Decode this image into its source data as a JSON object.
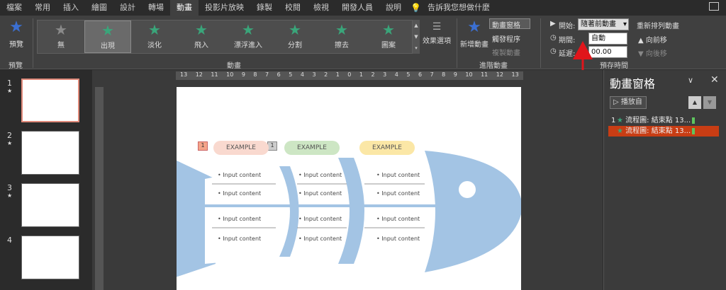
{
  "tabs": [
    "檔案",
    "常用",
    "插入",
    "繪圖",
    "設計",
    "轉場",
    "動畫",
    "投影片放映",
    "錄製",
    "校閱",
    "檢視",
    "開發人員",
    "說明"
  ],
  "tell_me": "告訴我您想做什麼",
  "ribbon": {
    "preview": "預覽",
    "preview_group": "預覽",
    "effects": [
      {
        "label": "無",
        "color": "#8a8a8a"
      },
      {
        "label": "出現",
        "color": "#3aa57a"
      },
      {
        "label": "淡化",
        "color": "#3aa57a"
      },
      {
        "label": "飛入",
        "color": "#3aa57a"
      },
      {
        "label": "漂浮進入",
        "color": "#3aa57a"
      },
      {
        "label": "分割",
        "color": "#3aa57a"
      },
      {
        "label": "擦去",
        "color": "#3aa57a"
      },
      {
        "label": "圖案",
        "color": "#3aa57a"
      }
    ],
    "effect_options": "效果選項",
    "animation_group": "動畫",
    "add_animation": "新增動畫",
    "animation_pane": "動畫窗格",
    "trigger": "觸發程序",
    "painter": "複製動畫",
    "advanced_group": "進階動畫",
    "start_label": "開始:",
    "start_value": "隨著前動畫",
    "duration_label": "期間:",
    "duration_value": "自動",
    "delay_label": "延遲:",
    "delay_value": "00.00",
    "timing_group": "預存時間",
    "reorder_title": "重新排列動畫",
    "move_earlier": "向前移",
    "move_later": "向後移"
  },
  "ruler": [
    "13",
    "12",
    "11",
    "10",
    "9",
    "8",
    "7",
    "6",
    "5",
    "4",
    "3",
    "2",
    "1",
    "0",
    "1",
    "2",
    "3",
    "4",
    "5",
    "6",
    "7",
    "8",
    "9",
    "10",
    "11",
    "12",
    "13"
  ],
  "slides": [
    {
      "num": "1",
      "star": "★"
    },
    {
      "num": "2",
      "star": "★"
    },
    {
      "num": "3",
      "star": "★"
    },
    {
      "num": "4",
      "star": ""
    }
  ],
  "slide": {
    "badge1": "1",
    "badge2": "1",
    "heads": [
      {
        "text": "EXAMPLE",
        "color": "#f9d9cf"
      },
      {
        "text": "EXAMPLE",
        "color": "#cde6c4"
      },
      {
        "text": "EXAMPLE",
        "color": "#fbe7a6"
      }
    ],
    "item": "Input content"
  },
  "pane": {
    "title": "動畫窗格",
    "play": "播放自",
    "items": [
      {
        "num": "1",
        "label": "流程圖: 結束點 13..."
      },
      {
        "num": "",
        "label": "流程圖: 結束點 13..."
      }
    ]
  }
}
